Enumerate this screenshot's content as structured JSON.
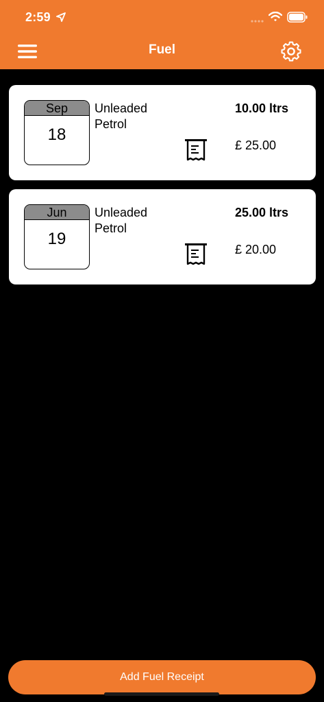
{
  "status_bar": {
    "time": "2:59"
  },
  "nav": {
    "title": "Fuel",
    "menu_icon": "hamburger-menu-icon",
    "settings_icon": "gear-icon"
  },
  "receipts": [
    {
      "month": "Sep",
      "day": "18",
      "fuel_type_line1": "Unleaded",
      "fuel_type_line2": "Petrol",
      "litres": "10.00 ltrs",
      "cost": "£ 25.00"
    },
    {
      "month": "Jun",
      "day": "19",
      "fuel_type_line1": "Unleaded",
      "fuel_type_line2": "Petrol",
      "litres": "25.00 ltrs",
      "cost": "£ 20.00"
    }
  ],
  "bottom": {
    "add_button_label": "Add Fuel Receipt"
  },
  "colors": {
    "accent": "#F07A2E",
    "background": "#000000",
    "card": "#FFFFFF",
    "calendar_header": "#8C8C8C"
  }
}
